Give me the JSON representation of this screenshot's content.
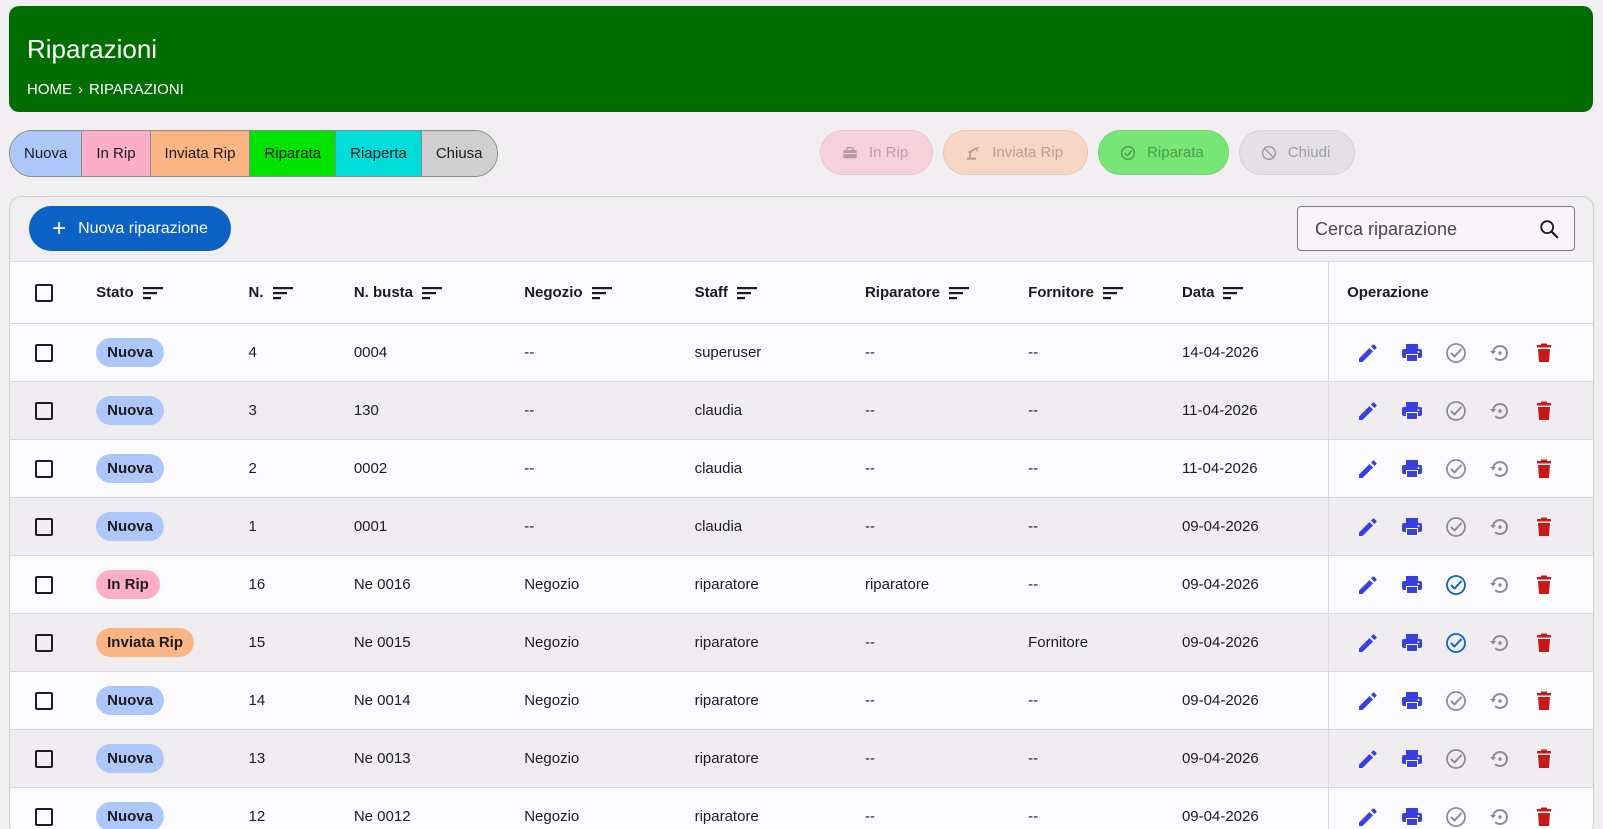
{
  "header": {
    "title": "Riparazioni",
    "breadcrumb": [
      "HOME",
      "RIPARAZIONI"
    ],
    "background": "#026d00"
  },
  "legend": [
    {
      "label": "Nuova",
      "color": "#aec7fb"
    },
    {
      "label": "In Rip",
      "color": "#fbaec7"
    },
    {
      "label": "Inviata Rip",
      "color": "#fbb584"
    },
    {
      "label": "Riparata",
      "color": "#00e200"
    },
    {
      "label": "Riaperta",
      "color": "#00dedc"
    },
    {
      "label": "Chiusa",
      "color": "#cfcfcf"
    }
  ],
  "bulk_actions": [
    {
      "label": "In Rip",
      "icon": "toolbox-icon",
      "bg": "#f7d2dd",
      "fg": "#b99aa5"
    },
    {
      "label": "Inviata Rip",
      "icon": "robot-arm-icon",
      "bg": "#f7d6c4",
      "fg": "#b79e90"
    },
    {
      "label": "Riparata",
      "icon": "check-circle-icon",
      "bg": "#77e677",
      "fg": "#4a9c4a"
    },
    {
      "label": "Chiudi",
      "icon": "block-icon",
      "bg": "#e3e1e4",
      "fg": "#9e9ca0"
    }
  ],
  "toolbar": {
    "new_label": "Nuova riparazione",
    "search_placeholder": "Cerca riparazione"
  },
  "table": {
    "columns": [
      "Stato",
      "N.",
      "N. busta",
      "Negozio",
      "Staff",
      "Riparatore",
      "Fornitore",
      "Data"
    ],
    "ops_header": "Operazione",
    "rows": [
      {
        "stato": "Nuova",
        "n": "4",
        "busta": "0004",
        "negozio": "--",
        "staff": "superuser",
        "riparatore": "--",
        "fornitore": "--",
        "data": "14-04-2026",
        "check_active": false
      },
      {
        "stato": "Nuova",
        "n": "3",
        "busta": "130",
        "negozio": "--",
        "staff": "claudia",
        "riparatore": "--",
        "fornitore": "--",
        "data": "11-04-2026",
        "check_active": false
      },
      {
        "stato": "Nuova",
        "n": "2",
        "busta": "0002",
        "negozio": "--",
        "staff": "claudia",
        "riparatore": "--",
        "fornitore": "--",
        "data": "11-04-2026",
        "check_active": false
      },
      {
        "stato": "Nuova",
        "n": "1",
        "busta": "0001",
        "negozio": "--",
        "staff": "claudia",
        "riparatore": "--",
        "fornitore": "--",
        "data": "09-04-2026",
        "check_active": false
      },
      {
        "stato": "In Rip",
        "n": "16",
        "busta": "Ne 0016",
        "negozio": "Negozio",
        "staff": "riparatore",
        "riparatore": "riparatore",
        "fornitore": "--",
        "data": "09-04-2026",
        "check_active": true
      },
      {
        "stato": "Inviata Rip",
        "n": "15",
        "busta": "Ne 0015",
        "negozio": "Negozio",
        "staff": "riparatore",
        "riparatore": "--",
        "fornitore": "Fornitore",
        "data": "09-04-2026",
        "check_active": true
      },
      {
        "stato": "Nuova",
        "n": "14",
        "busta": "Ne 0014",
        "negozio": "Negozio",
        "staff": "riparatore",
        "riparatore": "--",
        "fornitore": "--",
        "data": "09-04-2026",
        "check_active": false
      },
      {
        "stato": "Nuova",
        "n": "13",
        "busta": "Ne 0013",
        "negozio": "Negozio",
        "staff": "riparatore",
        "riparatore": "--",
        "fornitore": "--",
        "data": "09-04-2026",
        "check_active": false
      },
      {
        "stato": "Nuova",
        "n": "12",
        "busta": "Ne 0012",
        "negozio": "Negozio",
        "staff": "riparatore",
        "riparatore": "--",
        "fornitore": "--",
        "data": "09-04-2026",
        "check_active": false
      }
    ]
  },
  "colors": {
    "primary": "#0b62c4",
    "icon_blue": "#3a3fe0",
    "icon_gray": "#8f8d93",
    "check_blue": "#0b62c4",
    "delete_red": "#c61a1a"
  }
}
